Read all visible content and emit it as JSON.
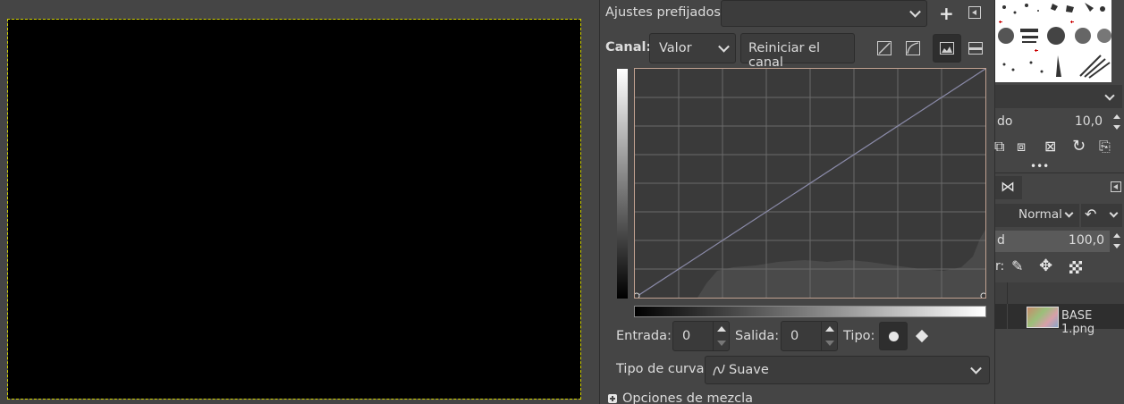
{
  "curves": {
    "presets_label": "Ajustes prefijados:",
    "preset_value": "",
    "channel_label": "Canal:",
    "channel_value": "Valor",
    "reset_channel_label": "Reiniciar el canal",
    "input_label": "Entrada:",
    "input_value": "0",
    "output_label": "Salida:",
    "output_value": "0",
    "type_label": "Tipo:",
    "curve_type_label": "Tipo de curva:",
    "curve_type_value": "Suave",
    "blend_options_label": "Opciones de mezcla"
  },
  "dock": {
    "size_label": "do",
    "size_value": "10,0",
    "mode_value": "Normal",
    "opacity_label": "d",
    "opacity_value": "100,0",
    "lock_label": "r:",
    "layer_name": "BASE 1.png"
  },
  "colors": {
    "background": "#454545",
    "canvas": "#000000",
    "selection_border": "#d8d800",
    "graph_bg": "#3a3a3a",
    "curve_line": "#8a8aa8"
  },
  "icons": [
    "plus-icon",
    "menu-icon",
    "linear-histogram-icon",
    "log-histogram-icon",
    "histogram-icon",
    "preview-icon",
    "point-smooth-icon",
    "point-corner-icon",
    "smooth-curve-icon"
  ]
}
